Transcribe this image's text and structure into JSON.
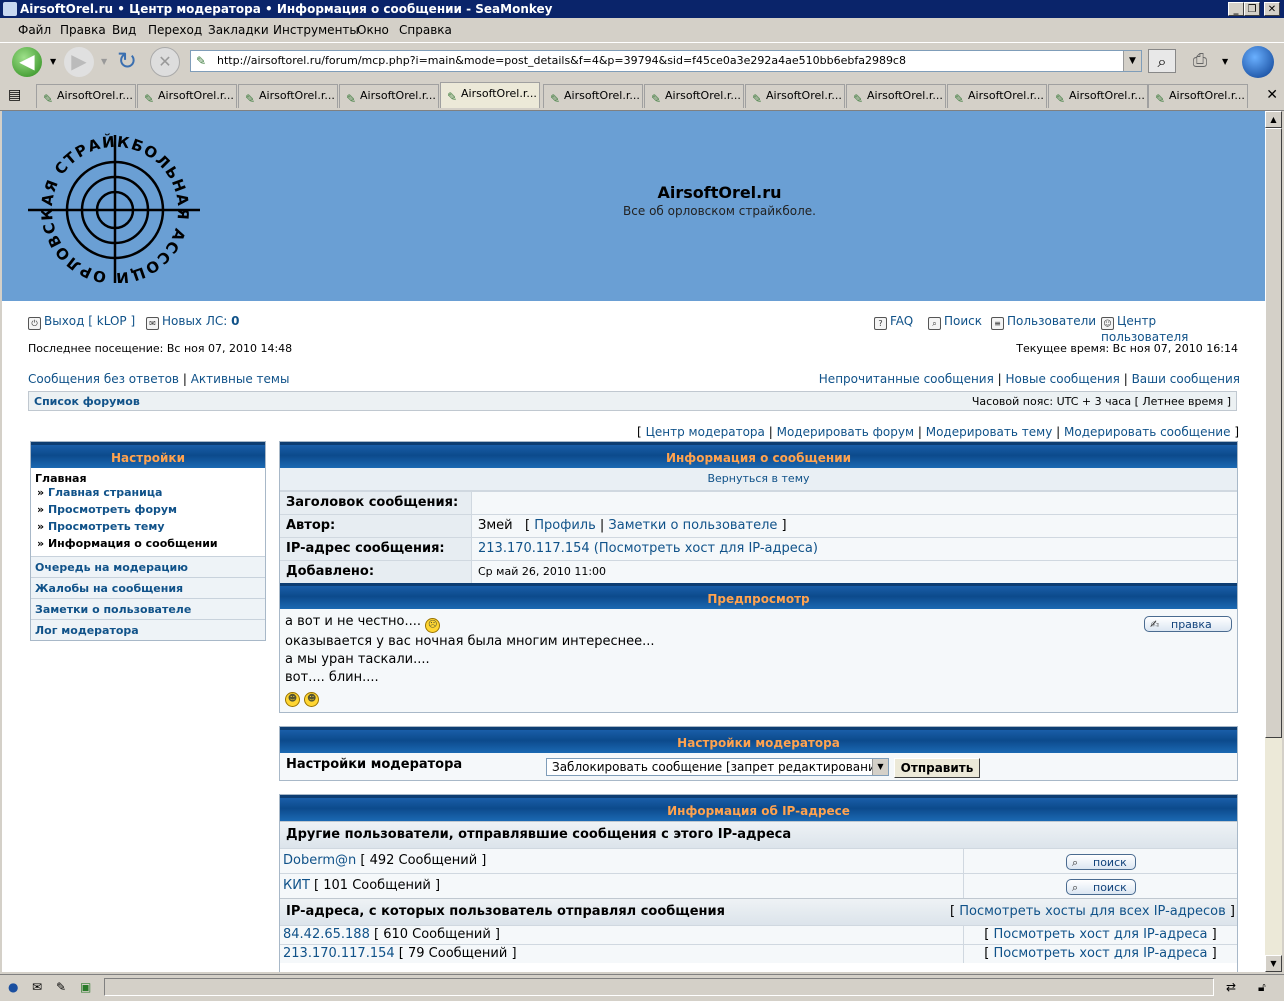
{
  "window": {
    "title": "AirsoftOrel.ru • Центр модератора • Информация о сообщении - SeaMonkey"
  },
  "menu": [
    "Файл",
    "Правка",
    "Вид",
    "Переход",
    "Закладки",
    "Инструменты",
    "Окно",
    "Справка"
  ],
  "url": "http://airsoftorel.ru/forum/mcp.php?i=main&mode=post_details&f=4&p=39794&sid=f45ce0a3e292a4ae510bb6ebfa2989c8",
  "tabs": [
    "AirsoftOrel.r...",
    "AirsoftOrel.r...",
    "AirsoftOrel.r...",
    "AirsoftOrel.r...",
    "AirsoftOrel.r...",
    "AirsoftOrel.r...",
    "AirsoftOrel.r...",
    "AirsoftOrel.r...",
    "AirsoftOrel.r...",
    "AirsoftOrel.r...",
    "AirsoftOrel.r...",
    "AirsoftOrel.r..."
  ],
  "active_tab": 4,
  "site": {
    "title": "AirsoftOrel.ru",
    "description": "Все об орловском страйкболе.",
    "logo_text": "ОРЛОВСКАЯ СТРАЙКБОЛЬНАЯ АССОЦИАЦИЯ"
  },
  "top": {
    "logout": "Выход [ kLOP ]",
    "pm_label": "Новых ЛС:",
    "pm_count": "0",
    "faq": "FAQ",
    "search": "Поиск",
    "members": "Пользователи",
    "ucp": "Центр пользователя"
  },
  "visit": {
    "last": "Последнее посещение: Вс ноя 07, 2010 14:48",
    "current": "Текущее время: Вс ноя 07, 2010 16:14"
  },
  "nav": {
    "unanswered": "Сообщения без ответов",
    "active": "Активные темы",
    "unread": "Непрочитанные сообщения",
    "new": "Новые сообщения",
    "yours": "Ваши сообщения",
    "sep": "|"
  },
  "crumb": {
    "forum_list": "Список форумов",
    "timezone": "Часовой пояс: UTC + 3 часа [ Летнее время ]"
  },
  "mod_links": {
    "open": "[",
    "close": "]",
    "sep": "|",
    "items": [
      "Центр модератора",
      "Модерировать форум",
      "Модерировать тему",
      "Модерировать сообщение"
    ]
  },
  "sidebar": {
    "title": "Настройки",
    "main": "Главная",
    "bullet": "»",
    "sub": [
      "Главная страница",
      "Просмотреть форум",
      "Просмотреть тему",
      "Информация о сообщении"
    ],
    "items": [
      "Очередь на модерацию",
      "Жалобы на сообщения",
      "Заметки о пользователе",
      "Лог модератора"
    ]
  },
  "post_info": {
    "title": "Информация о сообщении",
    "back": "Вернуться в тему",
    "subject_label": "Заголовок сообщения:",
    "subject_value": "",
    "author_label": "Автор:",
    "author_value": "Змей",
    "author_open": "[",
    "author_close": "]",
    "author_sep": "|",
    "profile": "Профиль",
    "notes": "Заметки о пользователе",
    "ip_label": "IP-адрес сообщения:",
    "ip_value": "213.170.117.154",
    "ip_host": "(Посмотреть хост для IP-адреса)",
    "posted_label": "Добавлено:",
    "posted_value": "Ср май 26, 2010 11:00"
  },
  "preview": {
    "title": "Предпросмотр",
    "lines": [
      "а вот и не честно....",
      "оказывается у вас ночная была многим интереснее...",
      "а мы уран таскали....",
      "вот.... блин...."
    ],
    "edit": "правка"
  },
  "mod_options": {
    "title": "Настройки модератора",
    "label": "Настройки модератора",
    "selected": "Заблокировать сообщение [запрет редактирования]",
    "submit": "Отправить"
  },
  "ip_info": {
    "title": "Информация об IP-адресе",
    "other_users": "Другие пользователи, отправлявшие сообщения с этого IP-адреса",
    "users": [
      {
        "name": "Doberm@n",
        "count": "[ 492 Сообщений ]"
      },
      {
        "name": "КИТ",
        "count": "[ 101 Сообщений ]"
      }
    ],
    "search": "поиск",
    "user_ips": "IP-адреса, с которых пользователь отправлял сообщения",
    "all_hosts": "Посмотреть хосты для всех IP-адресов",
    "open": "[",
    "close": "]",
    "ips": [
      {
        "ip": "84.42.65.188",
        "count": "[ 610 Сообщений ]"
      },
      {
        "ip": "213.170.117.154",
        "count": "[ 79 Сообщений ]"
      }
    ],
    "host": "Посмотреть хост для IP-адреса"
  }
}
